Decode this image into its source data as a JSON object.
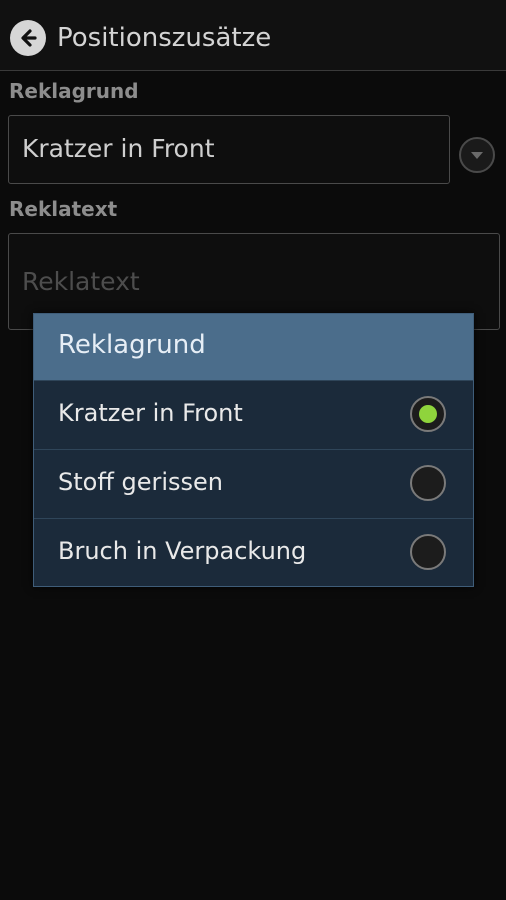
{
  "header": {
    "title": "Positionszusätze",
    "back_icon": "arrow-left-icon"
  },
  "form": {
    "reason_label": "Reklagrund",
    "reason_value": "Kratzer in Front",
    "dropdown_icon": "chevron-down-icon",
    "text_label": "Reklatext",
    "text_placeholder": "Reklatext"
  },
  "dialog": {
    "title": "Reklagrund",
    "options": [
      {
        "label": "Kratzer in Front",
        "selected": true
      },
      {
        "label": "Stoff gerissen",
        "selected": false
      },
      {
        "label": "Bruch in Verpackung",
        "selected": false
      }
    ],
    "selected_color": "#8fd43c"
  }
}
